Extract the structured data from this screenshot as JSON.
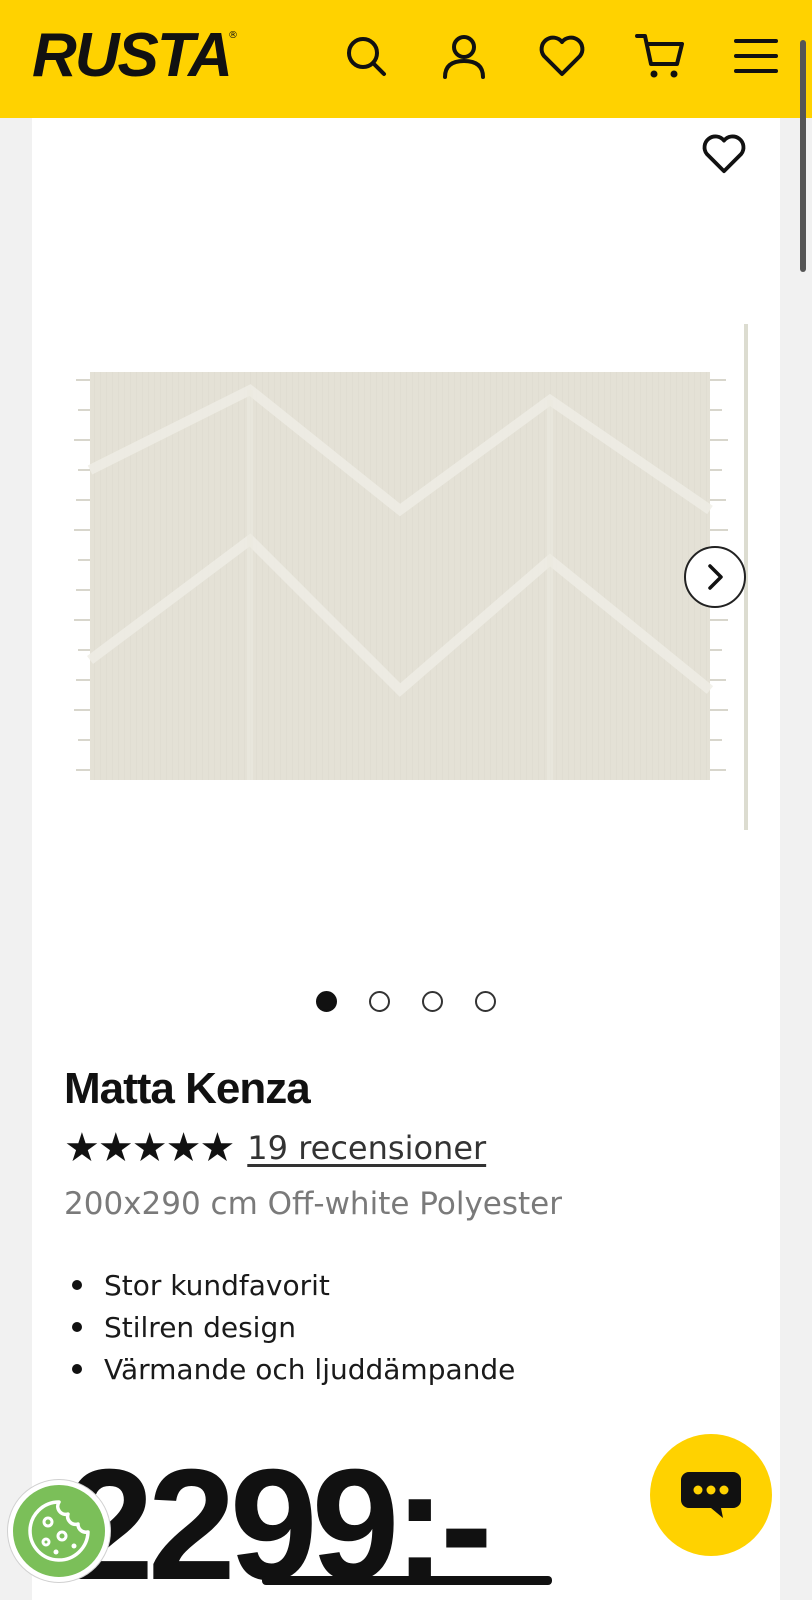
{
  "header": {
    "logo_text": "RUSTA",
    "logo_mark": "®",
    "background_color": "#ffd200",
    "icons": [
      "search-icon",
      "account-icon",
      "wishlist-icon",
      "cart-icon",
      "menu-icon"
    ]
  },
  "gallery": {
    "favorite_icon": "heart-outline-icon",
    "next_icon": "chevron-right-icon",
    "slides_total": 4,
    "active_slide": 1
  },
  "product": {
    "title": "Matta Kenza",
    "stars": "★★★★★",
    "rating_out_of_5": 5,
    "reviews_label": "19 recensioner",
    "subtitle": "200x290 cm Off-white Polyester",
    "features": [
      "Stor kundfavorit",
      "Stilren design",
      "Värmande och ljuddämpande"
    ],
    "price": "2299:-"
  },
  "floating": {
    "chat_icon": "chat-bubble-icon",
    "cookie_icon": "cookie-icon",
    "chat_color": "#ffd200",
    "cookie_color": "#7bbf59"
  }
}
